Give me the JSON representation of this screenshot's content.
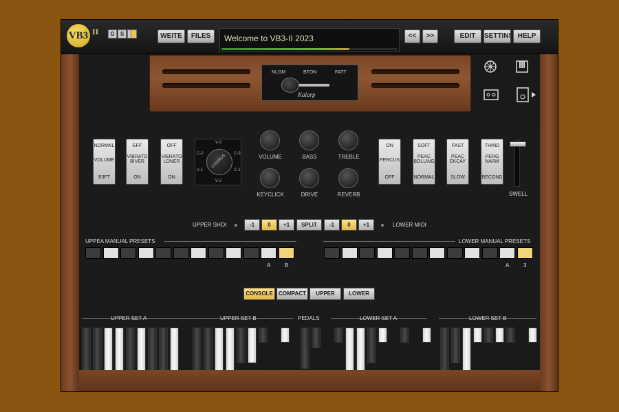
{
  "app": {
    "logo": "VB3",
    "logo_sup": "II",
    "mini_buttons": [
      "G",
      "S",
      "I",
      ""
    ]
  },
  "toolbar": {
    "write": "WEITE",
    "files": "FILES",
    "prev": "<<",
    "next": ">>",
    "edit": "EDIT",
    "settings": "SETTINSS",
    "help": "HELP"
  },
  "display": {
    "message": "Welcome to VB3-II 2023",
    "meter_level": 0.72
  },
  "selector": {
    "labels": [
      "NLOM",
      "BTON",
      "FATT"
    ],
    "brand": "Kalarp"
  },
  "rockers": [
    {
      "top": "NORMAL",
      "mid": "VOLUME",
      "bot": "B3FT"
    },
    {
      "top": "EFF",
      "mid": "VIBRATO BIVER",
      "bot": "ON"
    },
    {
      "top": "OFF",
      "mid": "VIERATO LONER",
      "bot": "ON"
    },
    {
      "top": "ON",
      "mid": "PERCUS",
      "bot": "OFF"
    },
    {
      "top": "SOFT",
      "mid": "PEAC BOLLING",
      "bot": "NORMAL"
    },
    {
      "top": "FAST",
      "mid": "PEAC EKCAY",
      "bot": "SLOW"
    },
    {
      "top": "THIND",
      "mid": "PERG NARM",
      "bot": "BECOND"
    }
  ],
  "vibrato_knob": {
    "labels": [
      "V-3",
      "C-3",
      "C-2",
      "V-1",
      "C-1",
      "V-2"
    ],
    "center": "CHORUS"
  },
  "knobs": [
    "VOLUME",
    "BASS",
    "TREBLE",
    "KEYCLICK",
    "DRIVE",
    "REVERB"
  ],
  "swell_label": "SWELL",
  "shift": {
    "upper_label": "UPPER SHOI",
    "lower_label": "LOWER MIOI",
    "buttons": [
      "-1",
      "0",
      "+1",
      "SPLIT",
      "-1",
      "0",
      "+1"
    ]
  },
  "presets": {
    "upper_title": "UPPEA MANUAL PRESETS",
    "lower_title": "LOWER MANUAL PRESETS",
    "a": "A",
    "b": "B",
    "b_lower": "3"
  },
  "views": [
    "CONSOLE",
    "COMPACT",
    "UPPER",
    "LOWER"
  ],
  "drawbar_sets": [
    "UPPER SET A",
    "UPPER SET B",
    "PEDALS",
    "LOWER SET A",
    "LOWER SET B"
  ],
  "colors": {
    "accent": "#f1d57a",
    "wood": "#8b5231",
    "background": "#8a5510"
  }
}
